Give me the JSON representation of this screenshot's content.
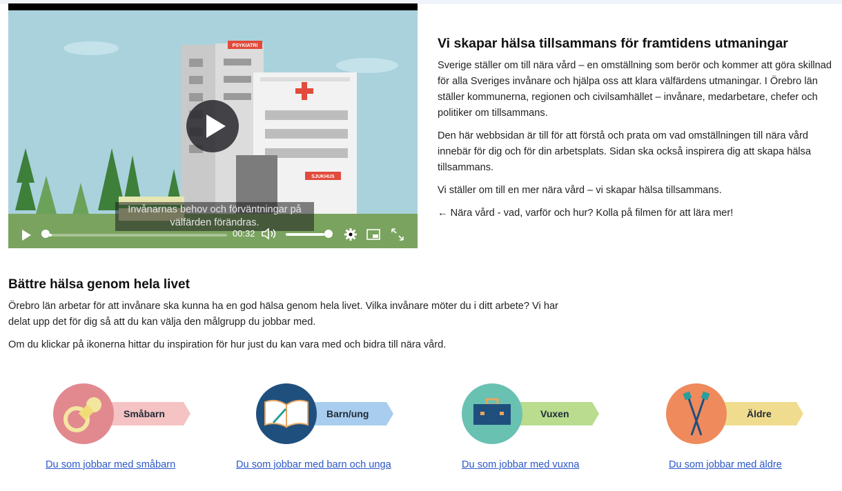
{
  "video": {
    "subtitle": "Invånarnas behov och förväntningar på välfärden förändras.",
    "time": "00:32",
    "progress": 0.03,
    "volume": 0.9,
    "sign_psykiatri": "PSYKIATRI",
    "sign_sjukhus": "SJUKHUS"
  },
  "intro": {
    "heading": "Vi skapar hälsa tillsammans för framtidens utmaningar",
    "p1": "Sverige ställer om till nära vård – en omställning som berör och kommer att göra skillnad för alla Sveriges invånare och hjälpa oss att klara välfärdens utmaningar. I Örebro län ställer kommunerna, regionen och civilsamhället – invånare, medarbetare, chefer och politiker om tillsammans.",
    "p2": "Den här webbsidan är till för att förstå och prata om vad omställningen till nära vård innebär för dig och för din arbetsplats. Sidan ska också inspirera dig att skapa hälsa tillsammans.",
    "p3": "Vi ställer om till en mer nära vård – vi skapar hälsa tillsammans.",
    "p4": "← Nära vård - vad, varför och hur? Kolla på filmen för att lära mer!"
  },
  "section": {
    "heading": "Bättre hälsa genom hela livet",
    "p1": "Örebro län arbetar för att invånare ska kunna ha en god hälsa genom hela livet. Vilka invånare möter du i ditt arbete? Vi har delat upp det för dig så att du kan välja den målgrupp du jobbar med.",
    "p2": "Om du klickar på ikonerna hittar du inspiration för hur just du kan vara med och bidra till nära vård."
  },
  "groups": [
    {
      "tag": "Småbarn",
      "link": "Du som jobbar med småbarn",
      "icon": "pacifier-icon",
      "circle_color": "#e2898f",
      "tag_color": "#f5c3c3"
    },
    {
      "tag": "Barn/ung",
      "link": "Du som jobbar med barn och unga",
      "icon": "book-icon",
      "circle_color": "#1f4f7d",
      "tag_color": "#a9cdee"
    },
    {
      "tag": "Vuxen",
      "link": "Du som jobbar med vuxna",
      "icon": "briefcase-icon",
      "circle_color": "#69c1b2",
      "tag_color": "#b9dc8f"
    },
    {
      "tag": "Äldre",
      "link": "Du som jobbar med äldre",
      "icon": "walking-poles-icon",
      "circle_color": "#ef8a5d",
      "tag_color": "#f0dc8e"
    }
  ]
}
